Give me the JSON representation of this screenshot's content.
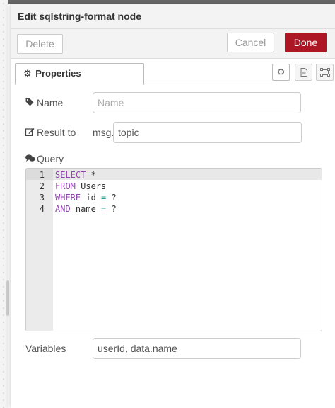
{
  "window": {
    "title": "Edit sqlstring-format node"
  },
  "toolbar": {
    "delete_label": "Delete",
    "cancel_label": "Cancel",
    "done_label": "Done"
  },
  "tabs": {
    "properties_label": "Properties"
  },
  "form": {
    "name_label": "Name",
    "name_placeholder": "Name",
    "result_label": "Result to",
    "result_prefix": "msg.",
    "result_value": "topic",
    "query_label": "Query",
    "variables_label": "Variables",
    "variables_value": "userId, data.name"
  },
  "editor": {
    "lines": [
      {
        "num": "1",
        "tokens": [
          {
            "t": "SELECT",
            "c": "kw"
          },
          {
            "t": " *",
            "c": ""
          }
        ]
      },
      {
        "num": "2",
        "tokens": [
          {
            "t": "FROM",
            "c": "kw"
          },
          {
            "t": " Users",
            "c": ""
          }
        ]
      },
      {
        "num": "3",
        "tokens": [
          {
            "t": "WHERE",
            "c": "kw"
          },
          {
            "t": " id ",
            "c": ""
          },
          {
            "t": "=",
            "c": "op"
          },
          {
            "t": " ?",
            "c": ""
          }
        ]
      },
      {
        "num": "4",
        "tokens": [
          {
            "t": "AND",
            "c": "kw"
          },
          {
            "t": " name ",
            "c": ""
          },
          {
            "t": "=",
            "c": "op"
          },
          {
            "t": " ?",
            "c": ""
          }
        ]
      }
    ]
  },
  "colors": {
    "done_button": "#ad1625",
    "keyword": "#8e44ad",
    "operator": "#2aa198"
  },
  "icons": [
    "gear-icon",
    "tag-icon",
    "edit-icon",
    "comments-icon",
    "document-icon",
    "frame-icon"
  ]
}
